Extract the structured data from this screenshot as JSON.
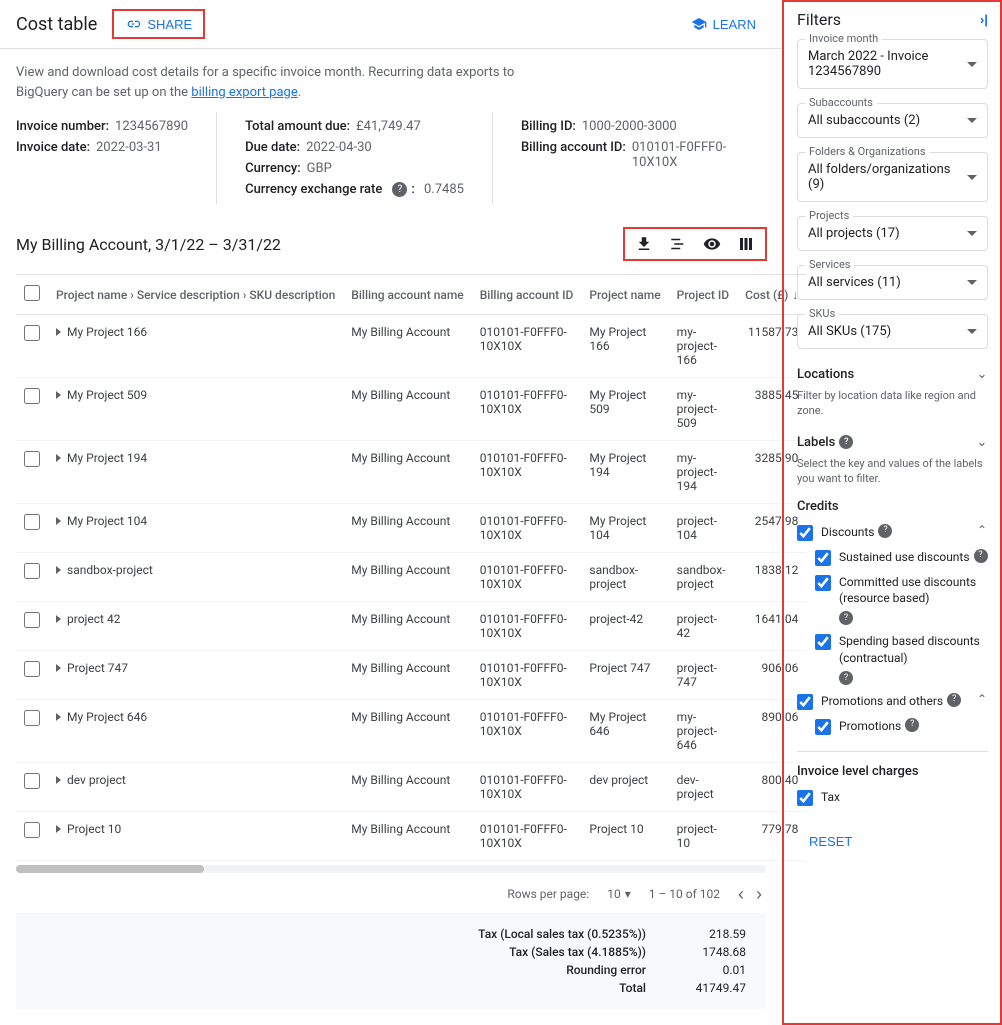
{
  "header": {
    "title": "Cost table",
    "share_label": "SHARE",
    "learn_label": "LEARN"
  },
  "description": {
    "line1": "View and download cost details for a specific invoice month. Recurring data exports to",
    "line2_prefix": "BigQuery can be set up on the ",
    "link_text": "billing export page",
    "line2_suffix": "."
  },
  "meta": {
    "col1": {
      "invoice_number_label": "Invoice number:",
      "invoice_number_value": "1234567890",
      "invoice_date_label": "Invoice date:",
      "invoice_date_value": "2022-03-31"
    },
    "col2": {
      "total_due_label": "Total amount due:",
      "total_due_value": "£41,749.47",
      "due_date_label": "Due date:",
      "due_date_value": "2022-04-30",
      "currency_label": "Currency:",
      "currency_value": "GBP",
      "rate_label": "Currency exchange rate",
      "rate_value": "0.7485"
    },
    "col3": {
      "billing_id_label": "Billing ID:",
      "billing_id_value": "1000-2000-3000",
      "billing_account_id_label": "Billing account ID:",
      "billing_account_id_value": "010101-F0FFF0-10X10X"
    }
  },
  "subheader": {
    "title": "My Billing Account, 3/1/22 – 3/31/22"
  },
  "table": {
    "headers": {
      "project_sku": "Project name › Service description › SKU description",
      "billing_account_name": "Billing account name",
      "billing_account_id": "Billing account ID",
      "project_name": "Project name",
      "project_id": "Project ID",
      "cost": "Cost (£)"
    },
    "rows": [
      {
        "p": "My Project 166",
        "ban": "My Billing Account",
        "baid": "010101-F0FFF0-10X10X",
        "pn": "My Project 166",
        "pid": "my-project-166",
        "cost": "11587.73"
      },
      {
        "p": "My Project 509",
        "ban": "My Billing Account",
        "baid": "010101-F0FFF0-10X10X",
        "pn": "My Project 509",
        "pid": "my-project-509",
        "cost": "3885.45"
      },
      {
        "p": "My Project 194",
        "ban": "My Billing Account",
        "baid": "010101-F0FFF0-10X10X",
        "pn": "My Project 194",
        "pid": "my-project-194",
        "cost": "3285.90"
      },
      {
        "p": "My Project 104",
        "ban": "My Billing Account",
        "baid": "010101-F0FFF0-10X10X",
        "pn": "My Project 104",
        "pid": "project-104",
        "cost": "2547.98"
      },
      {
        "p": "sandbox-project",
        "ban": "My Billing Account",
        "baid": "010101-F0FFF0-10X10X",
        "pn": "sandbox-project",
        "pid": "sandbox-project",
        "cost": "1838.12"
      },
      {
        "p": "project 42",
        "ban": "My Billing Account",
        "baid": "010101-F0FFF0-10X10X",
        "pn": "project-42",
        "pid": "project-42",
        "cost": "1641.04"
      },
      {
        "p": "Project 747",
        "ban": "My Billing Account",
        "baid": "010101-F0FFF0-10X10X",
        "pn": "Project 747",
        "pid": "project-747",
        "cost": "906.06"
      },
      {
        "p": "My Project 646",
        "ban": "My Billing Account",
        "baid": "010101-F0FFF0-10X10X",
        "pn": "My Project 646",
        "pid": "my-project-646",
        "cost": "890.06"
      },
      {
        "p": "dev project",
        "ban": "My Billing Account",
        "baid": "010101-F0FFF0-10X10X",
        "pn": "dev project",
        "pid": "dev-project",
        "cost": "800.40"
      },
      {
        "p": "Project 10",
        "ban": "My Billing Account",
        "baid": "010101-F0FFF0-10X10X",
        "pn": "Project 10",
        "pid": "project-10",
        "cost": "779.78"
      }
    ]
  },
  "pagination": {
    "rows_per_page_label": "Rows per page:",
    "rows_per_page_value": "10",
    "range": "1 – 10 of 102"
  },
  "totals": {
    "r1_label": "Tax (Local sales tax (0.5235%))",
    "r1_value": "218.59",
    "r2_label": "Tax (Sales tax (4.1885%))",
    "r2_value": "1748.68",
    "r3_label": "Rounding error",
    "r3_value": "0.01",
    "r4_label": "Total",
    "r4_value": "41749.47"
  },
  "filters": {
    "title": "Filters",
    "invoice_month": {
      "label": "Invoice month",
      "value": "March 2022 - Invoice 1234567890"
    },
    "subaccounts": {
      "label": "Subaccounts",
      "value": "All subaccounts (2)"
    },
    "folders": {
      "label": "Folders & Organizations",
      "value": "All folders/organizations (9)"
    },
    "projects": {
      "label": "Projects",
      "value": "All projects (17)"
    },
    "services": {
      "label": "Services",
      "value": "All services (11)"
    },
    "skus": {
      "label": "SKUs",
      "value": "All SKUs (175)"
    },
    "locations": {
      "title": "Locations",
      "desc": "Filter by location data like region and zone."
    },
    "labels": {
      "title": "Labels",
      "desc": "Select the key and values of the labels you want to filter."
    },
    "credits": {
      "title": "Credits",
      "discounts": "Discounts",
      "sustained": "Sustained use discounts",
      "committed": "Committed use discounts (resource based)",
      "spending": "Spending based discounts (contractual)",
      "promo_others": "Promotions and others",
      "promotions": "Promotions"
    },
    "invoice_charges": {
      "title": "Invoice level charges",
      "tax": "Tax"
    },
    "reset": "RESET"
  }
}
